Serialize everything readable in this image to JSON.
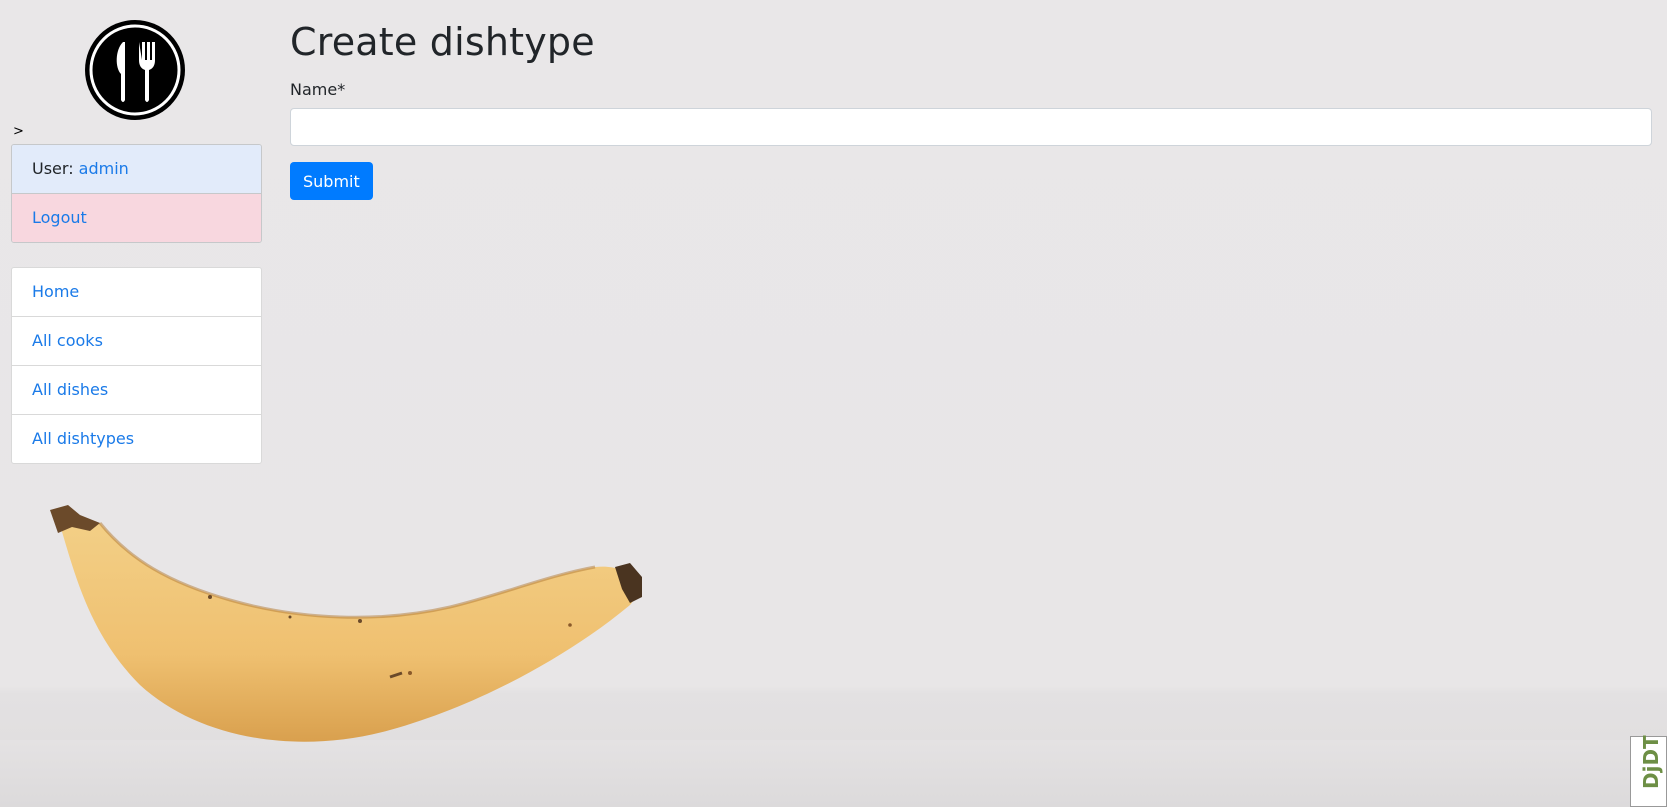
{
  "sidebar": {
    "logo_icon": "fork-knife-icon",
    "toggle_glyph": ">",
    "user_label": "User: ",
    "username": "admin",
    "logout_label": "Logout",
    "nav": [
      {
        "label": "Home"
      },
      {
        "label": "All cooks"
      },
      {
        "label": "All dishes"
      },
      {
        "label": "All dishtypes"
      }
    ]
  },
  "main": {
    "title": "Create dishtype",
    "name_label": "Name*",
    "name_value": "",
    "submit_label": "Submit"
  },
  "debug_toolbar": {
    "label": "DjDT"
  },
  "colors": {
    "link": "#1a7ae8",
    "primary": "#007bff",
    "user_bg": "#e2ebfa",
    "logout_bg": "#f8d7df"
  }
}
